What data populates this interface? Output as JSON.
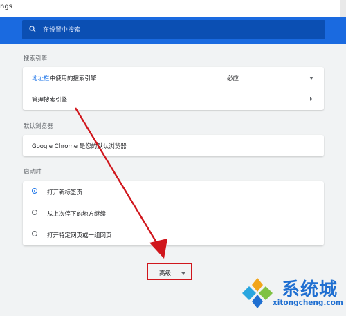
{
  "address_bar": {
    "text": "ngs"
  },
  "search": {
    "placeholder": "在设置中搜索"
  },
  "search_engine": {
    "title": "搜索引擎",
    "row1": {
      "link": "地址栏",
      "rest": "中使用的搜索引擎",
      "value": "必应"
    },
    "row2": {
      "label": "管理搜索引擎"
    }
  },
  "default_browser": {
    "title": "默认浏览器",
    "text": "Google Chrome 是您的默认浏览器"
  },
  "startup": {
    "title": "启动时",
    "options": [
      {
        "label": "打开新标签页",
        "selected": true
      },
      {
        "label": "从上次停下的地方继续",
        "selected": false
      },
      {
        "label": "打开特定网页或一组网页",
        "selected": false
      }
    ]
  },
  "advanced": {
    "label": "高级"
  },
  "watermark": {
    "brand": "系统城",
    "url": "xitongcheng.com"
  },
  "colors": {
    "header": "#1a6ae0",
    "accent": "#1a73e8",
    "annotation": "#d0161c"
  }
}
